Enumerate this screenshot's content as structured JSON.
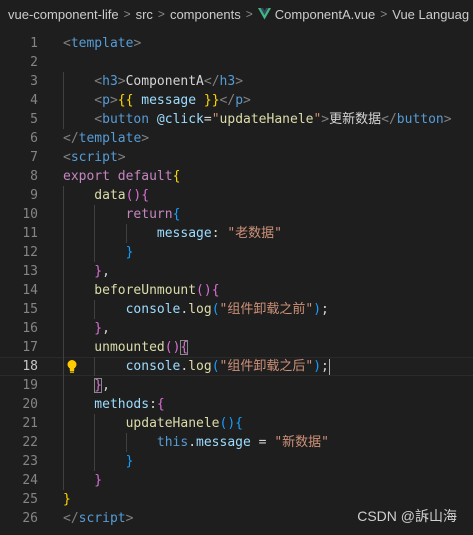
{
  "breadcrumb": {
    "items": [
      "vue-component-life",
      "src",
      "components",
      "ComponentA.vue",
      "Vue Languag"
    ],
    "separator": ">",
    "file_icon": "vue-logo-icon"
  },
  "editor": {
    "active_line": 18,
    "lines": [
      {
        "n": "1",
        "indent": 0,
        "tokens": [
          [
            "t-br",
            "<"
          ],
          [
            "t-tag",
            "template"
          ],
          [
            "t-br",
            ">"
          ]
        ]
      },
      {
        "n": "2",
        "indent": 0,
        "tokens": []
      },
      {
        "n": "3",
        "indent": 1,
        "tokens": [
          [
            "t-br",
            "<"
          ],
          [
            "t-tag",
            "h3"
          ],
          [
            "t-br",
            ">"
          ],
          [
            "t-txt",
            "ComponentA"
          ],
          [
            "t-br",
            "</"
          ],
          [
            "t-tag",
            "h3"
          ],
          [
            "t-br",
            ">"
          ]
        ]
      },
      {
        "n": "4",
        "indent": 1,
        "tokens": [
          [
            "t-br",
            "<"
          ],
          [
            "t-tag",
            "p"
          ],
          [
            "t-br",
            ">"
          ],
          [
            "t-b1",
            "{{ "
          ],
          [
            "t-prop",
            "message"
          ],
          [
            "t-b1",
            " }}"
          ],
          [
            "t-br",
            "</"
          ],
          [
            "t-tag",
            "p"
          ],
          [
            "t-br",
            ">"
          ]
        ]
      },
      {
        "n": "5",
        "indent": 1,
        "tokens": [
          [
            "t-br",
            "<"
          ],
          [
            "t-tag",
            "button"
          ],
          [
            "t-txt",
            " "
          ],
          [
            "t-attr",
            "@click"
          ],
          [
            "t-txt",
            "="
          ],
          [
            "t-str",
            "\""
          ],
          [
            "t-fn",
            "updateHanele"
          ],
          [
            "t-str",
            "\""
          ],
          [
            "t-br",
            ">"
          ],
          [
            "t-txt",
            "更新数据"
          ],
          [
            "t-br",
            "</"
          ],
          [
            "t-tag",
            "button"
          ],
          [
            "t-br",
            ">"
          ]
        ]
      },
      {
        "n": "6",
        "indent": 0,
        "tokens": [
          [
            "t-br",
            "</"
          ],
          [
            "t-tag",
            "template"
          ],
          [
            "t-br",
            ">"
          ]
        ]
      },
      {
        "n": "7",
        "indent": 0,
        "tokens": [
          [
            "t-br",
            "<"
          ],
          [
            "t-tag",
            "script"
          ],
          [
            "t-br",
            ">"
          ]
        ]
      },
      {
        "n": "8",
        "indent": 0,
        "tokens": [
          [
            "t-kw2",
            "export"
          ],
          [
            "t-txt",
            " "
          ],
          [
            "t-kw2",
            "default"
          ],
          [
            "t-b1",
            "{"
          ]
        ]
      },
      {
        "n": "9",
        "indent": 1,
        "tokens": [
          [
            "t-fn",
            "data"
          ],
          [
            "t-b2",
            "()"
          ],
          [
            "t-b2",
            "{"
          ]
        ]
      },
      {
        "n": "10",
        "indent": 2,
        "tokens": [
          [
            "t-kw2",
            "return"
          ],
          [
            "t-b3",
            "{"
          ]
        ]
      },
      {
        "n": "11",
        "indent": 3,
        "tokens": [
          [
            "t-prop",
            "message"
          ],
          [
            "t-txt",
            ": "
          ],
          [
            "t-str",
            "\"老数据\""
          ]
        ]
      },
      {
        "n": "12",
        "indent": 2,
        "tokens": [
          [
            "t-b3",
            "}"
          ]
        ]
      },
      {
        "n": "13",
        "indent": 1,
        "tokens": [
          [
            "t-b2",
            "}"
          ],
          [
            "t-txt",
            ","
          ]
        ]
      },
      {
        "n": "14",
        "indent": 1,
        "tokens": [
          [
            "t-fn",
            "beforeUnmount"
          ],
          [
            "t-b2",
            "()"
          ],
          [
            "t-b2",
            "{"
          ]
        ]
      },
      {
        "n": "15",
        "indent": 2,
        "tokens": [
          [
            "t-prop",
            "console"
          ],
          [
            "t-txt",
            "."
          ],
          [
            "t-fn",
            "log"
          ],
          [
            "t-b3",
            "("
          ],
          [
            "t-str",
            "\"组件卸载之前\""
          ],
          [
            "t-b3",
            ")"
          ],
          [
            "t-txt",
            ";"
          ]
        ]
      },
      {
        "n": "16",
        "indent": 1,
        "tokens": [
          [
            "t-b2",
            "}"
          ],
          [
            "t-txt",
            ","
          ]
        ]
      },
      {
        "n": "17",
        "indent": 1,
        "tokens": [
          [
            "t-fn",
            "unmounted"
          ],
          [
            "t-b2",
            "()"
          ],
          [
            "t-b2",
            "{",
            "bm"
          ]
        ]
      },
      {
        "n": "18",
        "indent": 2,
        "tokens": [
          [
            "t-prop",
            "console"
          ],
          [
            "t-txt",
            "."
          ],
          [
            "t-fn",
            "log"
          ],
          [
            "t-b3",
            "("
          ],
          [
            "t-str",
            "\"组件卸载之后\""
          ],
          [
            "t-b3",
            ")"
          ],
          [
            "t-txt",
            ";"
          ]
        ],
        "cursor": true
      },
      {
        "n": "19",
        "indent": 1,
        "tokens": [
          [
            "t-b2",
            "}",
            "bm"
          ],
          [
            "t-txt",
            ","
          ]
        ]
      },
      {
        "n": "20",
        "indent": 1,
        "tokens": [
          [
            "t-prop",
            "methods"
          ],
          [
            "t-txt",
            ":"
          ],
          [
            "t-b2",
            "{"
          ]
        ]
      },
      {
        "n": "21",
        "indent": 2,
        "tokens": [
          [
            "t-fn",
            "updateHanele"
          ],
          [
            "t-b3",
            "()"
          ],
          [
            "t-b3",
            "{"
          ]
        ]
      },
      {
        "n": "22",
        "indent": 3,
        "tokens": [
          [
            "t-kw",
            "this"
          ],
          [
            "t-txt",
            "."
          ],
          [
            "t-prop",
            "message"
          ],
          [
            "t-txt",
            " = "
          ],
          [
            "t-str",
            "\"新数据\""
          ]
        ]
      },
      {
        "n": "23",
        "indent": 2,
        "tokens": [
          [
            "t-b3",
            "}"
          ]
        ]
      },
      {
        "n": "24",
        "indent": 1,
        "tokens": [
          [
            "t-b2",
            "}"
          ]
        ]
      },
      {
        "n": "25",
        "indent": 0,
        "tokens": [
          [
            "t-b1",
            "}"
          ]
        ]
      },
      {
        "n": "26",
        "indent": 0,
        "tokens": [
          [
            "t-br",
            "</"
          ],
          [
            "t-tag",
            "script"
          ],
          [
            "t-br",
            ">"
          ]
        ]
      }
    ],
    "lightbulb_icon": "lightbulb-icon"
  },
  "watermark": "CSDN @訴山海",
  "colors": {
    "background": "#1e1e1e",
    "line_number": "#858585",
    "vue_green": "#41b883"
  }
}
